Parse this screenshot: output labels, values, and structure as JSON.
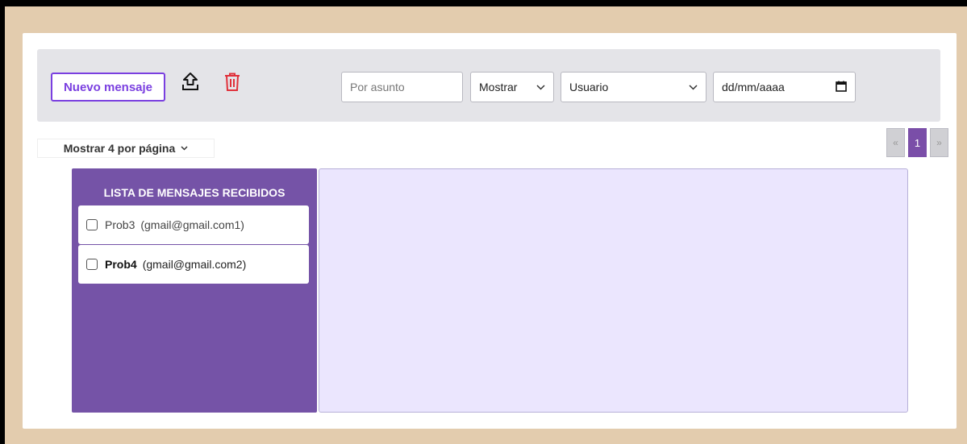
{
  "toolbar": {
    "new_message_label": "Nuevo mensaje",
    "upload_icon": "upload-icon",
    "trash_icon": "trash-icon",
    "search_placeholder": "Por asunto",
    "show_select_value": "Mostrar",
    "user_select_value": "Usuario",
    "date_placeholder": "dd/mm/aaaa"
  },
  "per_page": {
    "label": "Mostrar 4 por página"
  },
  "pagination": {
    "prev": "«",
    "current": "1",
    "next": "»"
  },
  "inbox": {
    "title": "LISTA DE MENSAJES RECIBIDOS",
    "messages": [
      {
        "subject": "Prob3",
        "email": "(gmail@gmail.com1)"
      },
      {
        "subject": "Prob4",
        "email": "(gmail@gmail.com2)"
      }
    ]
  },
  "colors": {
    "accent": "#7a3fe0",
    "trash": "#e0303a",
    "sidebar": "#7553a7",
    "content_bg": "#ebe6fe",
    "frame": "#e3ccae"
  }
}
